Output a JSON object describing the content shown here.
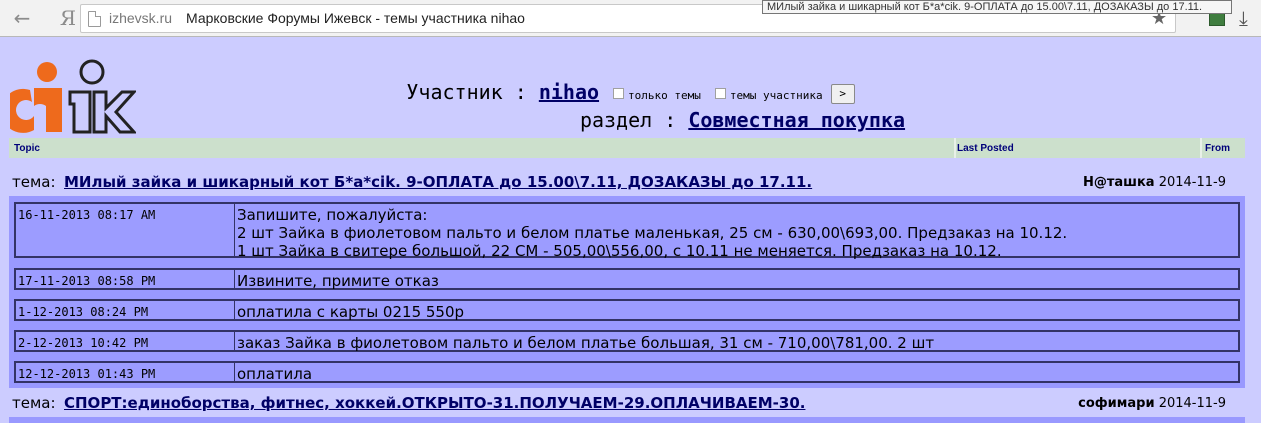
{
  "browser": {
    "back_glyph": "←",
    "ya_glyph": "Я",
    "url_domain": "izhevsk.ru",
    "tab_title": "Марковские Форумы Ижевск - темы участника nihao",
    "star_glyph": "★",
    "download_glyph": "⤓",
    "tooltip": "МИлый зайка и шикарный кот Б*а*cik. 9-ОПЛАТА до 15.00\\7.11, ДОЗАКАЗЫ до 17.11."
  },
  "header": {
    "member_label": "Участник : ",
    "member_name": "nihao",
    "only_topics_label": "только темы",
    "member_topics_label": "темы участника",
    "go_label": ">",
    "section_label": "раздел : ",
    "section_name": "Совместная покупка"
  },
  "columns": {
    "topic": "Topic",
    "last_posted": "Last Posted",
    "from": "From"
  },
  "topics": [
    {
      "prefix": "тема: ",
      "title": "МИлый зайка и шикарный кот Б*а*cik. 9-ОПЛАТА до 15.00\\7.11, ДОЗАКАЗЫ до 17.11.",
      "author": "Н@ташка",
      "date": "2014-11-9",
      "posts": [
        {
          "date": "16-11-2013 08:17 AM",
          "lines": [
            "Запишите, пожалуйста:",
            "2 шт Зайка в фиолетовом пальто и белом платье маленькая, 25 см - 630,00\\693,00. Предзаказ на 10.12.",
            "1 шт Зайка в свитере большой, 22 СМ - 505,00\\556,00, с 10.11 не меняется. Предзаказ на 10.12."
          ]
        },
        {
          "date": "17-11-2013 08:58 PM",
          "lines": [
            "Извините, примите отказ"
          ]
        },
        {
          "date": "1-12-2013 08:24 PM",
          "lines": [
            "оплатила с карты 0215 550р"
          ]
        },
        {
          "date": "2-12-2013 10:42 PM",
          "lines": [
            "заказ Зайка в фиолетовом пальто и белом платье большая, 31 см - 710,00\\781,00. 2 шт"
          ]
        },
        {
          "date": "12-12-2013 01:43 PM",
          "lines": [
            "оплатила"
          ]
        }
      ]
    },
    {
      "prefix": "тема: ",
      "title": "СПОРТ:единоборства, фитнес, хоккей.ОТКРЫТО-31.ПОЛУЧАЕМ-29.ОПЛАЧИВАЕМ-30.",
      "author": "софимари",
      "date": "2014-11-9",
      "posts": []
    }
  ],
  "colors": {
    "page_bg": "#ccccff",
    "post_bg": "#9c9cff",
    "post_border": "#333366",
    "link": "#000066",
    "logo_orange": "#ee6a1c",
    "logo_dark": "#222222"
  }
}
